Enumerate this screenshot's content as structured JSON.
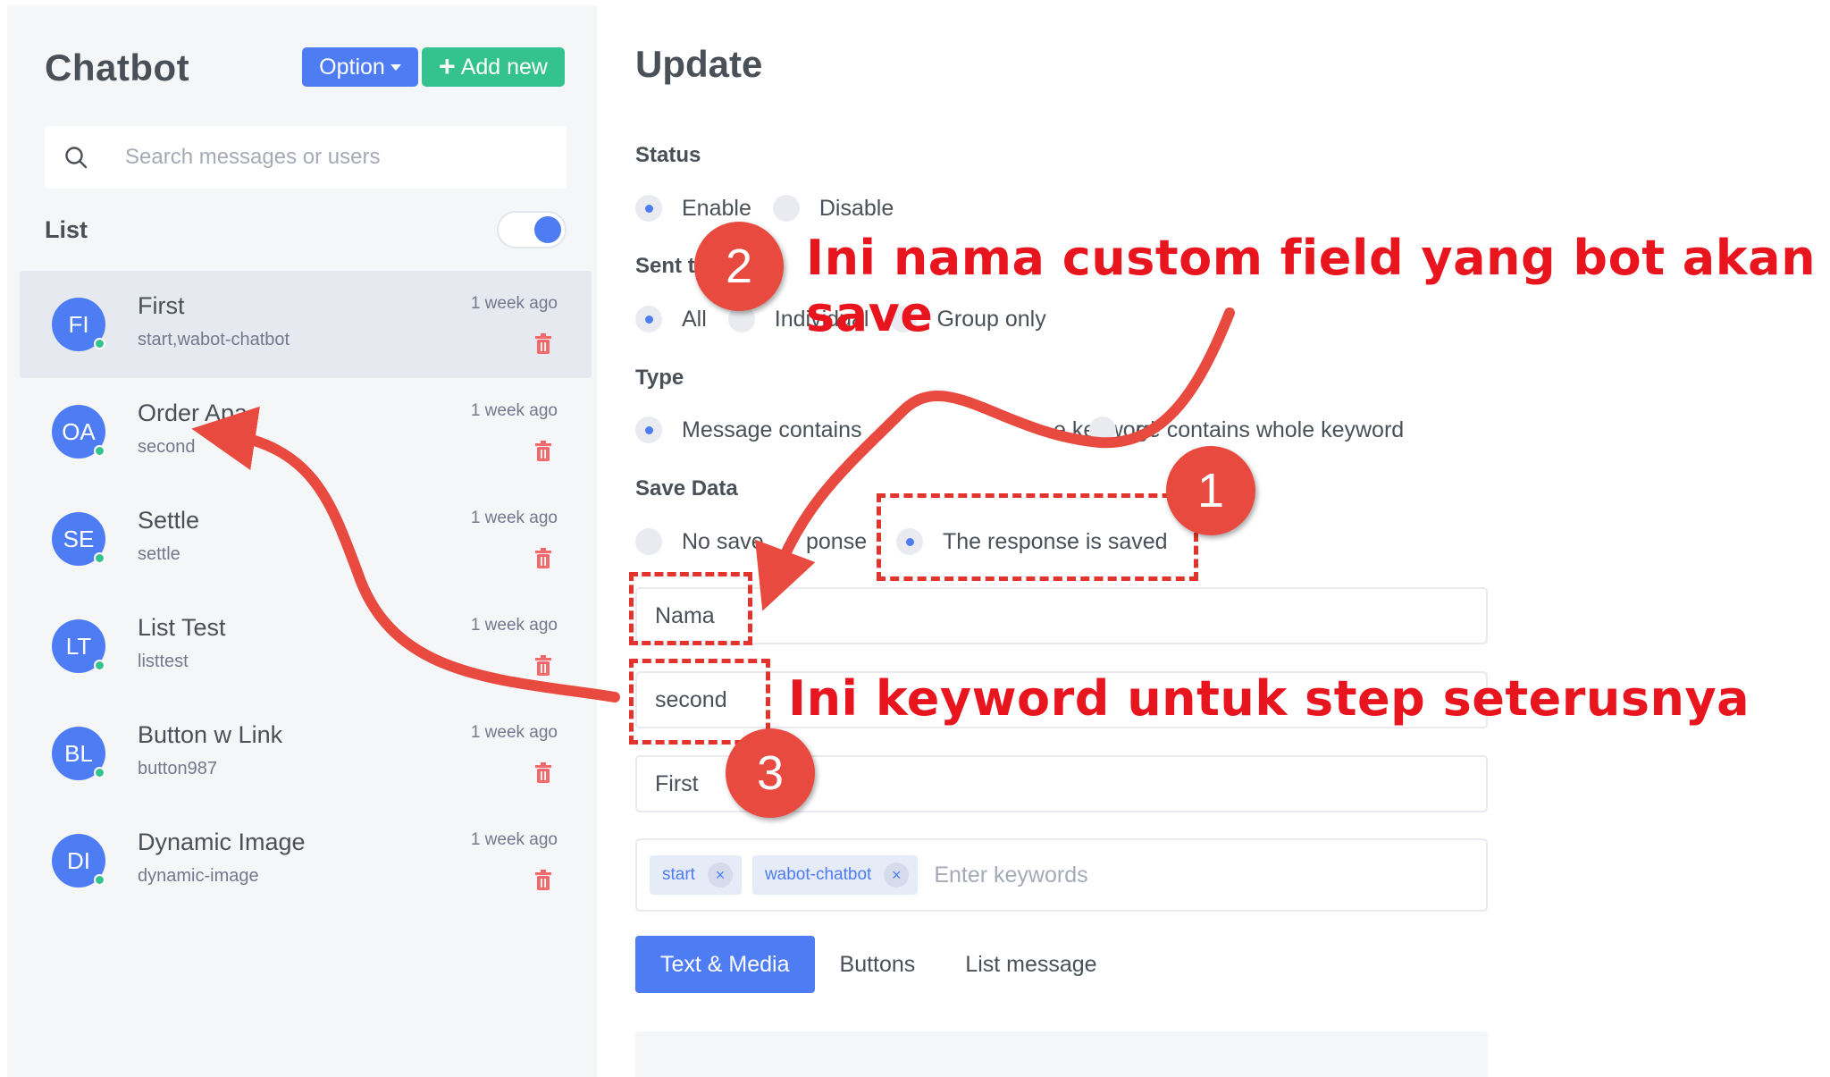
{
  "sidebar": {
    "title": "Chatbot",
    "option_label": "Option",
    "add_label": "Add new",
    "search_placeholder": "Search messages or users",
    "list_label": "List",
    "list_toggle_on": true,
    "items": [
      {
        "initials": "FI",
        "name": "First",
        "sub": "start,wabot-chatbot",
        "time": "1 week ago",
        "active": true
      },
      {
        "initials": "OA",
        "name": "Order Apa",
        "sub": "second",
        "time": "1 week ago",
        "active": false
      },
      {
        "initials": "SE",
        "name": "Settle",
        "sub": "settle",
        "time": "1 week ago",
        "active": false
      },
      {
        "initials": "LT",
        "name": "List Test",
        "sub": "listtest",
        "time": "1 week ago",
        "active": false
      },
      {
        "initials": "BL",
        "name": "Button w Link",
        "sub": "button987",
        "time": "1 week ago",
        "active": false
      },
      {
        "initials": "DI",
        "name": "Dynamic Image",
        "sub": "dynamic-image",
        "time": "1 week ago",
        "active": false
      }
    ]
  },
  "main": {
    "title": "Update",
    "status": {
      "label": "Status",
      "options": [
        "Enable",
        "Disable"
      ],
      "selected": "Enable"
    },
    "sent": {
      "label": "Sent t",
      "options": [
        "All",
        "Individual",
        "Group only"
      ],
      "selected": "All"
    },
    "type": {
      "label": "Type",
      "options": [
        "Message contains the keyword",
        "Message contains whole keyword"
      ],
      "visible_text": [
        "Message contains",
        "e keyword",
        "ge contains whole keyword"
      ],
      "selected": "Message contains the keyword"
    },
    "save_data": {
      "label": "Save Data",
      "options": [
        "No save response",
        "The response is saved"
      ],
      "visible_text": [
        "No save ",
        "ponse"
      ],
      "selected": "The response is saved"
    },
    "field_name_value": "Nama",
    "next_keyword_value": "second",
    "title_value": "First",
    "keywords": [
      "start",
      "wabot-chatbot"
    ],
    "keyword_placeholder": "Enter keywords",
    "tabs": [
      "Text & Media",
      "Buttons",
      "List message"
    ],
    "active_tab": "Text & Media"
  },
  "annotations": {
    "badge_1": "1",
    "badge_2": "2",
    "badge_3": "3",
    "text_2": "Ini nama custom field yang bot akan save",
    "text_3": "Ini keyword untuk step seterusnya",
    "color": "#e8141e"
  },
  "colors": {
    "primary": "#4e7cf2",
    "success": "#34c38f",
    "danger": "#f46a6a",
    "sidebar_bg": "#f5f6f8"
  }
}
